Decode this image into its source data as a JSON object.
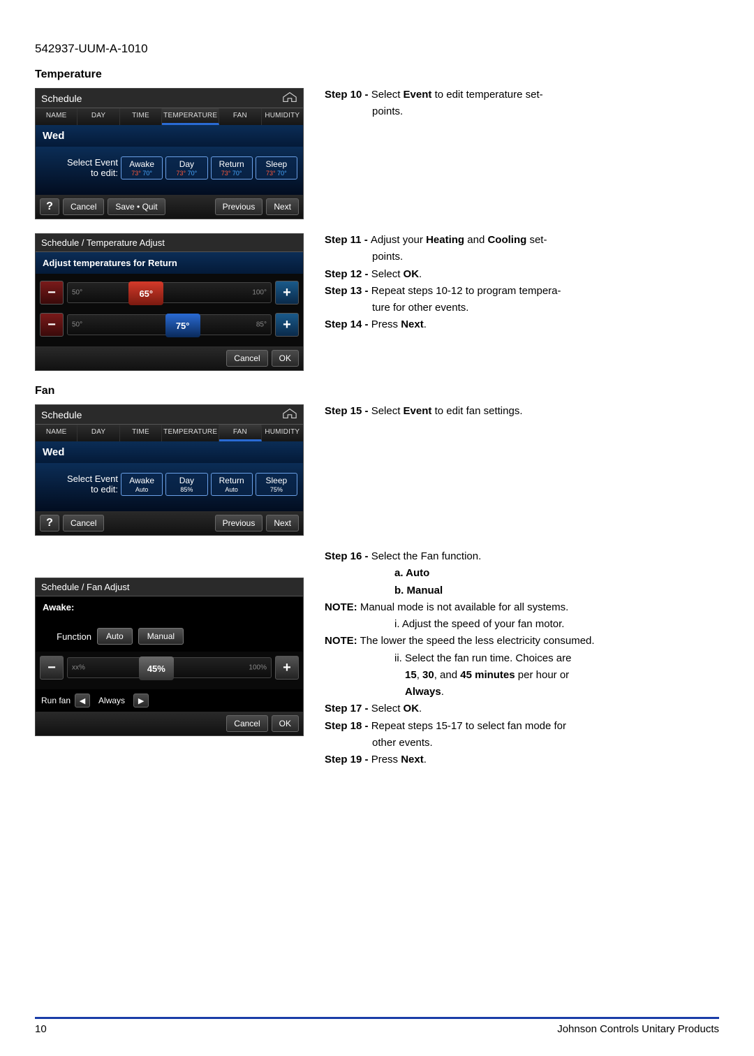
{
  "doc_id": "542937-UUM-A-1010",
  "sections": {
    "temperature_title": "Temperature",
    "fan_title": "Fan"
  },
  "panel1": {
    "header": "Schedule",
    "tabs": [
      "NAME",
      "DAY",
      "TIME",
      "TEMPERATURE",
      "FAN",
      "HUMIDITY"
    ],
    "active_tab": 3,
    "day": "Wed",
    "select_label_l1": "Select Event",
    "select_label_l2": "to edit:",
    "events": [
      {
        "name": "Awake",
        "sub_heat": "73°",
        "sub_cool": "70°"
      },
      {
        "name": "Day",
        "sub_heat": "73°",
        "sub_cool": "70°"
      },
      {
        "name": "Return",
        "sub_heat": "73°",
        "sub_cool": "70°"
      },
      {
        "name": "Sleep",
        "sub_heat": "73°",
        "sub_cool": "70°"
      }
    ],
    "btn_help": "?",
    "btn_cancel": "Cancel",
    "btn_savequit": "Save • Quit",
    "btn_prev": "Previous",
    "btn_next": "Next"
  },
  "panel2": {
    "title": "Schedule / Temperature Adjust",
    "sub": "Adjust temperatures for Return",
    "heat_min": "50°",
    "heat_max": "100°",
    "heat_val": "65°",
    "cool_min": "50°",
    "cool_max": "85°",
    "cool_val": "75°",
    "btn_cancel": "Cancel",
    "btn_ok": "OK"
  },
  "panel3": {
    "header": "Schedule",
    "tabs": [
      "NAME",
      "DAY",
      "TIME",
      "TEMPERATURE",
      "FAN",
      "HUMIDITY"
    ],
    "active_tab": 4,
    "day": "Wed",
    "select_label_l1": "Select Event",
    "select_label_l2": "to edit:",
    "events": [
      {
        "name": "Awake",
        "sub": "Auto"
      },
      {
        "name": "Day",
        "sub": "85%"
      },
      {
        "name": "Return",
        "sub": "Auto"
      },
      {
        "name": "Sleep",
        "sub": "75%"
      }
    ],
    "btn_help": "?",
    "btn_cancel": "Cancel",
    "btn_prev": "Previous",
    "btn_next": "Next"
  },
  "panel4": {
    "title": "Schedule / Fan Adjust",
    "sub": "Awake:",
    "func_label": "Function",
    "func_auto": "Auto",
    "func_manual": "Manual",
    "slider_min": "xx%",
    "slider_max": "100%",
    "slider_val": "45%",
    "runfan_label": "Run fan",
    "runfan_val": "Always",
    "btn_cancel": "Cancel",
    "btn_ok": "OK"
  },
  "steps": {
    "s10": "Step 10 - ",
    "s10_text": "Select Event to edit temperature set-",
    "s10_cont": "points.",
    "s11": "Step 11 - ",
    "s11_text": "Adjust your Heating and Cooling set-",
    "s11_cont": "points.",
    "s12": "Step 12 - ",
    "s12_text": "Select OK.",
    "s13": "Step 13 - ",
    "s13_text": "Repeat steps 10-12 to program tempera-",
    "s13_cont": "ture for other events.",
    "s14": "Step 14 - ",
    "s14_text": "Press Next.",
    "s15": "Step 15 - ",
    "s15_text": "Select Event to edit fan settings.",
    "s16": "Step 16 - ",
    "s16_text": "Select the Fan function.",
    "s16a": "a. Auto",
    "s16b": "b. Manual",
    "note1": "NOTE: Manual mode is not available for all systems.",
    "s16i": "i. Adjust the speed of your fan motor.",
    "note2": "NOTE: The lower the speed the less electricity consumed.",
    "s16ii_a": "ii. Select the fan run time. Choices are",
    "s16ii_b": "15, 30, and 45 minutes per hour or",
    "s16ii_c": "Always.",
    "s17": "Step 17 - ",
    "s17_text": "Select OK.",
    "s18": "Step 18 - ",
    "s18_text": "Repeat steps 15-17 to select fan mode for",
    "s18_cont": "other events.",
    "s19": "Step 19 - ",
    "s19_text": "Press Next."
  },
  "footer": {
    "page": "10",
    "company": "Johnson Controls Unitary Products"
  }
}
